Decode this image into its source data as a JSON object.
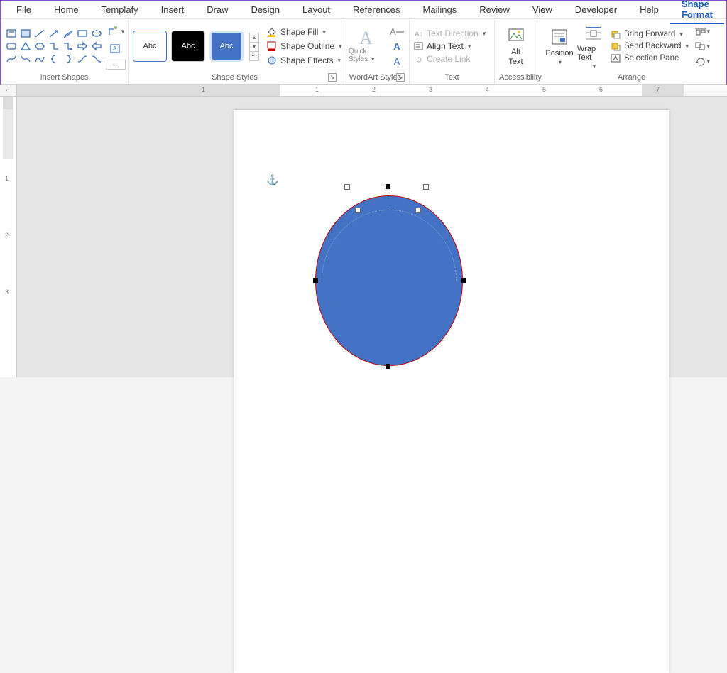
{
  "menu": {
    "items": [
      "File",
      "Home",
      "Templafy",
      "Insert",
      "Draw",
      "Design",
      "Layout",
      "References",
      "Mailings",
      "Review",
      "View",
      "Developer",
      "Help",
      "Shape Format"
    ],
    "active": "Shape Format"
  },
  "ribbon": {
    "insert_shapes": {
      "label": "Insert Shapes"
    },
    "shape_styles": {
      "label": "Shape Styles",
      "swatch_text": "Abc",
      "fill": "Shape Fill",
      "outline": "Shape Outline",
      "effects": "Shape Effects"
    },
    "wordart": {
      "label": "WordArt Styles",
      "big_a": "A",
      "quick_styles": "Quick Styles"
    },
    "text": {
      "label": "Text",
      "direction": "Text Direction",
      "align": "Align Text",
      "link": "Create Link"
    },
    "accessibility": {
      "label": "Accessibility",
      "alt_text_top": "Alt",
      "alt_text_bottom": "Text"
    },
    "arrange": {
      "label": "Arrange",
      "position": "Position",
      "wrap": "Wrap Text",
      "bring_forward": "Bring Forward",
      "send_backward": "Send Backward",
      "selection_pane": "Selection Pane"
    }
  },
  "ruler": {
    "h_numbers": [
      "1",
      "1",
      "2",
      "3",
      "4",
      "5",
      "6",
      "7"
    ]
  },
  "chart_data": null
}
